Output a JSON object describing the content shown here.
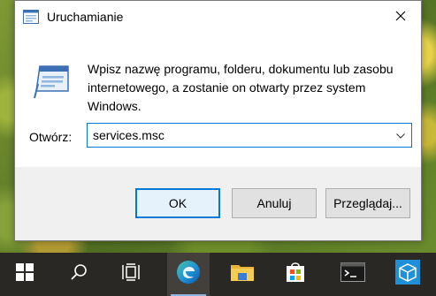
{
  "dialog": {
    "title": "Uruchamianie",
    "icons": {
      "title": "run-icon",
      "main": "run-icon",
      "close": "close-icon"
    },
    "description": "Wpisz nazwę programu, folderu, dokumentu lub zasobu internetowego, a zostanie on otwarty przez system Windows.",
    "open_label": "Otwórz:",
    "open_value": "services.msc",
    "buttons": {
      "ok": "OK",
      "cancel": "Anuluj",
      "browse": "Przeglądaj..."
    }
  },
  "taskbar": {
    "items": [
      {
        "icon": "start-windows-icon"
      },
      {
        "icon": "search-icon"
      },
      {
        "icon": "task-view-icon"
      },
      {
        "icon": "edge-browser-icon",
        "active": true
      },
      {
        "icon": "file-explorer-icon"
      },
      {
        "icon": "microsoft-store-icon"
      },
      {
        "icon": "terminal-icon"
      },
      {
        "icon": "box-app-icon"
      }
    ]
  },
  "colors": {
    "accent": "#0078d7",
    "taskbar": "#2a2824",
    "footer": "#f0f0f0"
  }
}
